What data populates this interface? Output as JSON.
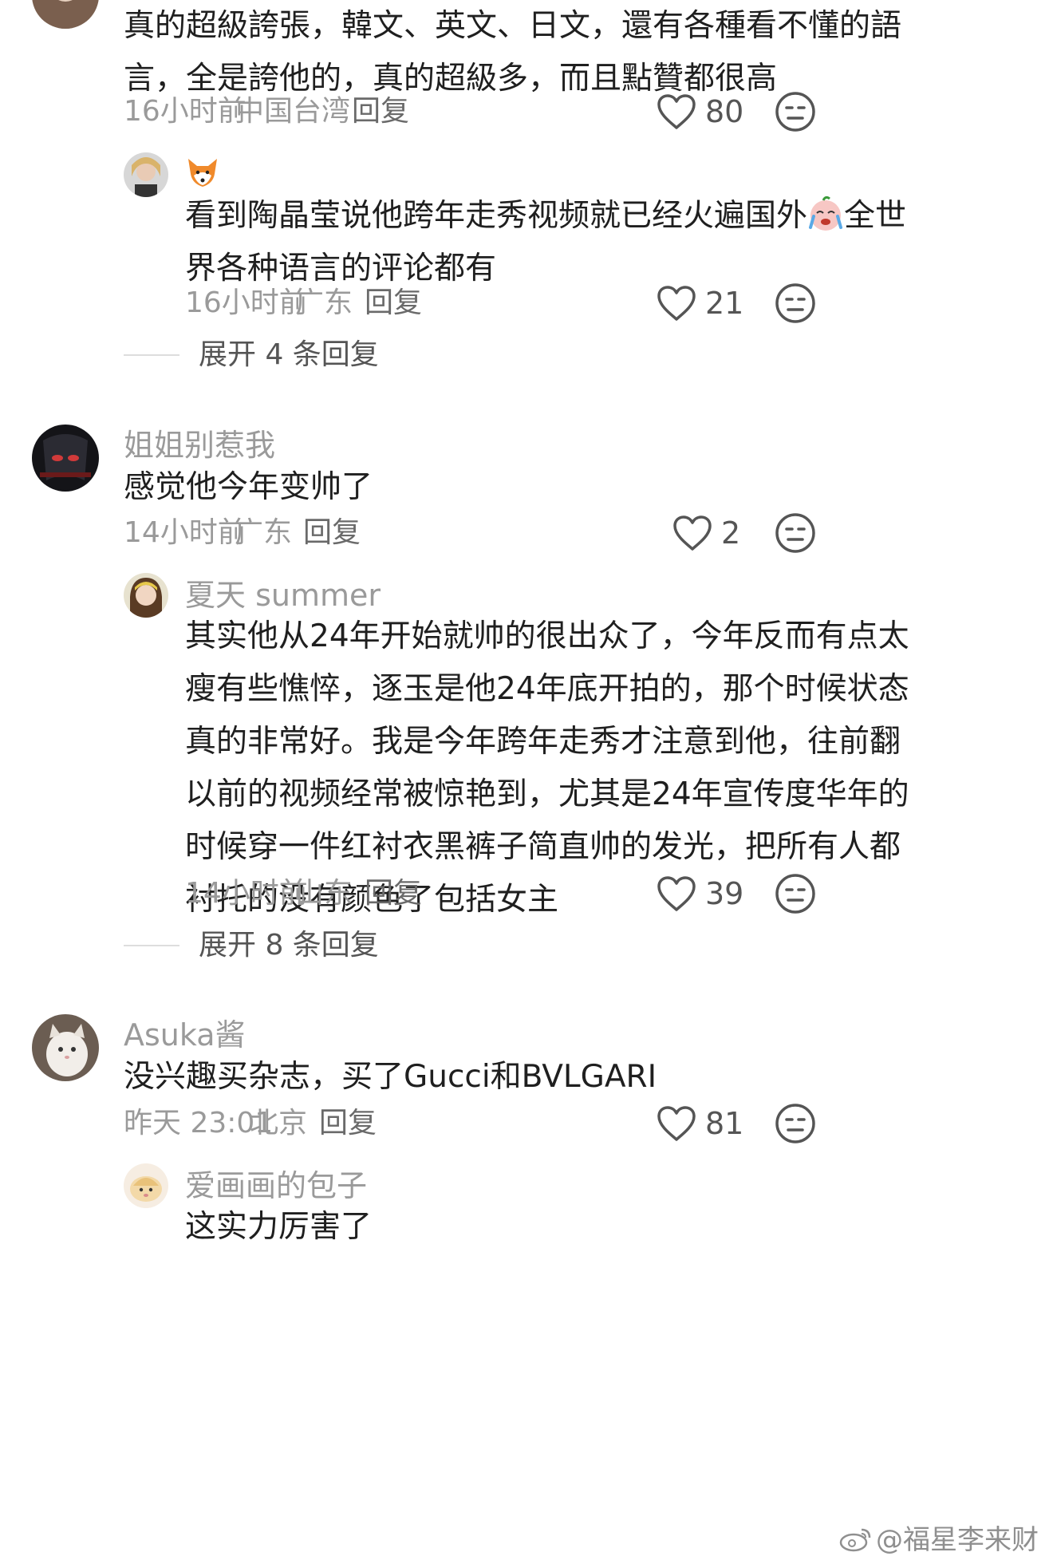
{
  "comments": [
    {
      "text_lines": [
        "真的超級誇張，韓文、英文、日文，還有各種看不懂的語",
        "言，全是誇他的，真的超級多，而且點贊都很高"
      ],
      "time": "16小时前",
      "location": "中国台湾",
      "reply_label": "回复",
      "likes": "80",
      "replies": [
        {
          "name_icon": "fox-emoji-icon",
          "text_line1_before": "看到陶晶莹说他跨年走秀视频就已经火遍国外",
          "inline_emoji": "crying-emoji-icon",
          "text_line1_after": "全世",
          "text_line2": "界各种语言的评论都有",
          "time": "16小时前",
          "location": "广东",
          "reply_label": "回复",
          "likes": "21"
        }
      ],
      "expand_label": "展开 4 条回复"
    },
    {
      "username": "姐姐别惹我",
      "text_lines": [
        "感觉他今年变帅了"
      ],
      "time": "14小时前",
      "location": "广东",
      "reply_label": "回复",
      "likes": "2",
      "replies": [
        {
          "username": "夏天 summer",
          "text_lines": [
            "其实他从24年开始就帅的很出众了，今年反而有点太",
            "瘦有些憔悴，逐玉是他24年底开拍的，那个时候状态",
            "真的非常好。我是今年跨年走秀才注意到他，往前翻",
            "以前的视频经常被惊艳到，尤其是24年宣传度华年的",
            "时候穿一件红衬衣黑裤子简直帅的发光，把所有人都",
            "衬托的没有颜色了包括女主"
          ],
          "time": "14小时前",
          "location": "山东",
          "reply_label": "回复",
          "likes": "39"
        }
      ],
      "expand_label": "展开 8 条回复"
    },
    {
      "username": "Asuka酱",
      "text_lines": [
        "没兴趣买杂志，买了Gucci和BVLGARI"
      ],
      "time": "昨天 23:01",
      "location": "北京",
      "reply_label": "回复",
      "likes": "81",
      "replies": [
        {
          "username": "爱画画的包子",
          "text_lines": [
            "这实力厉害了"
          ]
        }
      ]
    }
  ],
  "watermark": "@福星李来财",
  "colors": {
    "meta_gray": "#9a9a9a",
    "text": "#1f1f1f",
    "icon": "#555555"
  }
}
